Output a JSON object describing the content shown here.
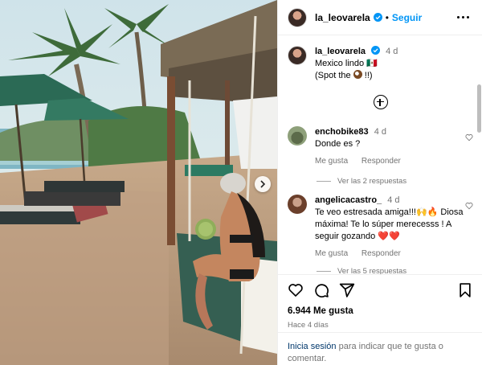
{
  "post": {
    "username": "la_leovarela",
    "follow_label": "Seguir",
    "caption_time": "4 d",
    "caption_line1": "Mexico lindo 🇲🇽",
    "caption_line2_prefix": "(Spot the",
    "caption_line2_suffix": "!!)"
  },
  "comments": [
    {
      "username": "enchobike83",
      "time": "4 d",
      "text": "Donde es ?",
      "like_label": "Me gusta",
      "reply_label": "Responder",
      "view_replies": "Ver las 2 respuestas"
    },
    {
      "username": "angelicacastro_",
      "time": "4 d",
      "text": "Te veo estresada amiga!!!🙌🔥 Diosa máxima! Te lo súper merecesss ! A seguir gozando ❤️❤️",
      "like_label": "Me gusta",
      "reply_label": "Responder",
      "view_replies": "Ver las 5 respuestas"
    }
  ],
  "stats": {
    "likes": "6.944 Me gusta",
    "posted_ago": "Hace 4 días"
  },
  "login_prompt": {
    "link": "Inicia sesión",
    "text": " para indicar que te gusta o comentar."
  },
  "colors": {
    "accent": "#0095f6",
    "muted": "#737373",
    "heart": "#ed4956"
  }
}
